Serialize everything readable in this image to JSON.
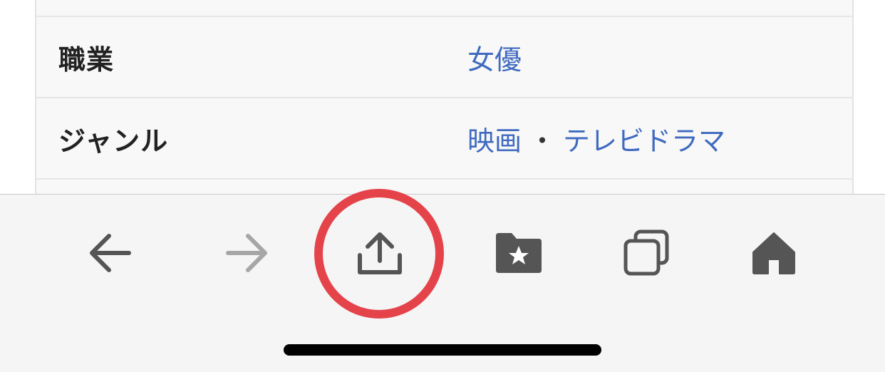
{
  "infobox": {
    "rows": [
      {
        "key": "",
        "values": []
      },
      {
        "key": "職業",
        "values": [
          "女優"
        ]
      },
      {
        "key": "ジャンル",
        "values": [
          "映画",
          "テレビドラマ"
        ],
        "separator": "・"
      },
      {
        "key": "",
        "values": []
      }
    ]
  },
  "toolbar": {
    "back_icon": "arrow-left-icon",
    "forward_icon": "arrow-right-icon",
    "share_icon": "share-upload-icon",
    "bookmarks_icon": "folder-star-icon",
    "tabs_icon": "tabs-icon",
    "home_icon": "home-icon",
    "forward_enabled": false
  },
  "colors": {
    "link": "#3f6ac0",
    "icon": "#555555",
    "icon_disabled": "#a6a6a6",
    "highlight": "#e5434a",
    "toolbar_bg": "#f5f5f5"
  }
}
